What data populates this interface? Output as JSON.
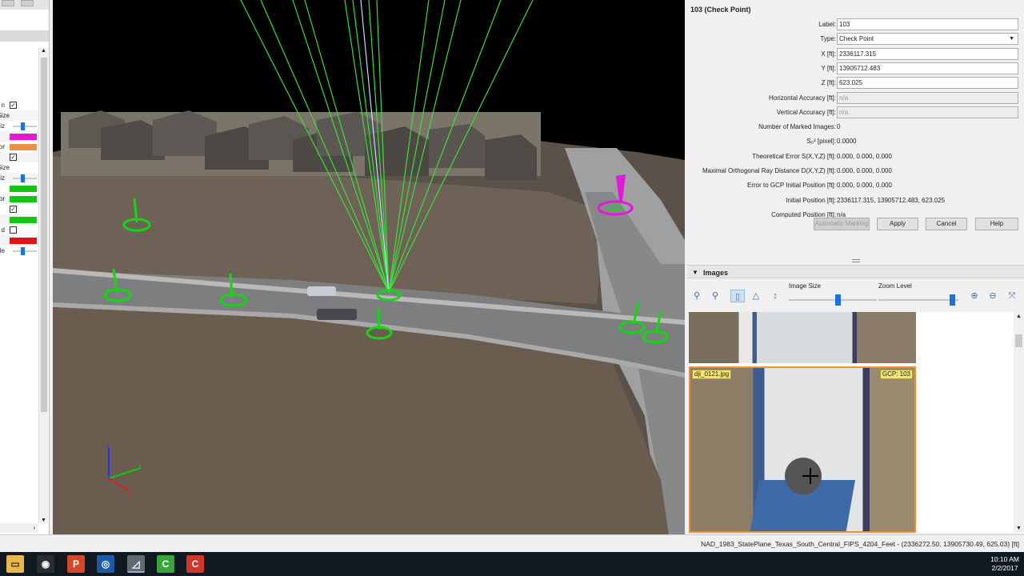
{
  "left_panel": {
    "rows": [
      {
        "label": "n",
        "control": "checkbox",
        "checked": true
      },
      {
        "label": "Size",
        "control": "none"
      },
      {
        "label": "cal Siz",
        "control": "slider"
      },
      {
        "label": "",
        "control": "swatch",
        "color": "#e21ad0"
      },
      {
        "label": "or",
        "control": "swatch",
        "color": "#e8914b"
      },
      {
        "label": "",
        "control": "checkbox",
        "checked": true
      },
      {
        "label": "Size",
        "control": "none"
      },
      {
        "label": "cal Siz",
        "control": "slider"
      },
      {
        "label": "",
        "control": "swatch",
        "color": "#15c415"
      },
      {
        "label": "or",
        "control": "swatch",
        "color": "#15c415"
      },
      {
        "label": "",
        "control": "checkbox",
        "checked": true
      },
      {
        "label": "",
        "control": "swatch",
        "color": "#15c415"
      },
      {
        "label": "d",
        "control": "checkbox",
        "checked": false
      },
      {
        "label": "",
        "control": "swatch",
        "color": "#e01414"
      },
      {
        "label": "le",
        "control": "slider"
      }
    ]
  },
  "viewport": {
    "axis_labels": {
      "z": "z",
      "y": "y",
      "x": "x"
    }
  },
  "properties": {
    "title": "103 (Check Point)",
    "rows": [
      {
        "label": "Label:",
        "kind": "field",
        "value": "103"
      },
      {
        "label": "Type:",
        "kind": "select",
        "value": "Check Point"
      },
      {
        "label": "X [ft]:",
        "kind": "field",
        "value": "2336117.315"
      },
      {
        "label": "Y [ft]:",
        "kind": "field",
        "value": "13905712.483"
      },
      {
        "label": "Z [ft]:",
        "kind": "field",
        "value": "623.025"
      },
      {
        "label": "Horizontal Accuracy [ft]:",
        "kind": "disabled",
        "value": "n/a"
      },
      {
        "label": "Vertical Accuracy [ft]:",
        "kind": "disabled",
        "value": "n/a"
      },
      {
        "label": "Number of Marked Images:",
        "kind": "text",
        "value": "0"
      },
      {
        "label": "S₀² [pixel]:",
        "kind": "text",
        "value": "0.0000"
      },
      {
        "label": "Theoretical Error S(X,Y,Z) [ft]:",
        "kind": "text",
        "value": "0.000, 0.000, 0.000"
      },
      {
        "label": "Maximal Orthogonal Ray Distance D(X,Y,Z) [ft]:",
        "kind": "text",
        "value": "0.000, 0.000, 0.000"
      },
      {
        "label": "Error to GCP Initial Position [ft]:",
        "kind": "text",
        "value": "0.000, 0.000, 0.000"
      },
      {
        "label": "Initial Position [ft]:",
        "kind": "text",
        "value": "2336117.315, 13905712.483, 623.025"
      },
      {
        "label": "Computed Position [ft]:",
        "kind": "text",
        "value": "n/a"
      }
    ],
    "buttons": {
      "automatic_marking": "Automatic Marking",
      "apply": "Apply",
      "cancel": "Cancel",
      "help": "Help"
    }
  },
  "images": {
    "title": "Images",
    "image_size_label": "Image Size",
    "zoom_level_label": "Zoom Level",
    "image_size_level": 0.55,
    "zoom_level": 0.92,
    "thumbnails": [
      {
        "file": "",
        "tag": ""
      },
      {
        "file": "dji_0121.jpg",
        "tag": "GCP: 103"
      }
    ]
  },
  "statusbar": {
    "text": "NAD_1983_StatePlane_Texas_South_Central_FIPS_4204_Feet - (2336272.50, 13905730.49, 625.03) [ft]"
  },
  "taskbar": {
    "time": "10:10 AM",
    "date": "2/2/2017",
    "apps": [
      "file-explorer",
      "chrome-app",
      "powerpoint",
      "globe-app",
      "pix4d",
      "camtasia-green",
      "camtasia-red"
    ]
  }
}
